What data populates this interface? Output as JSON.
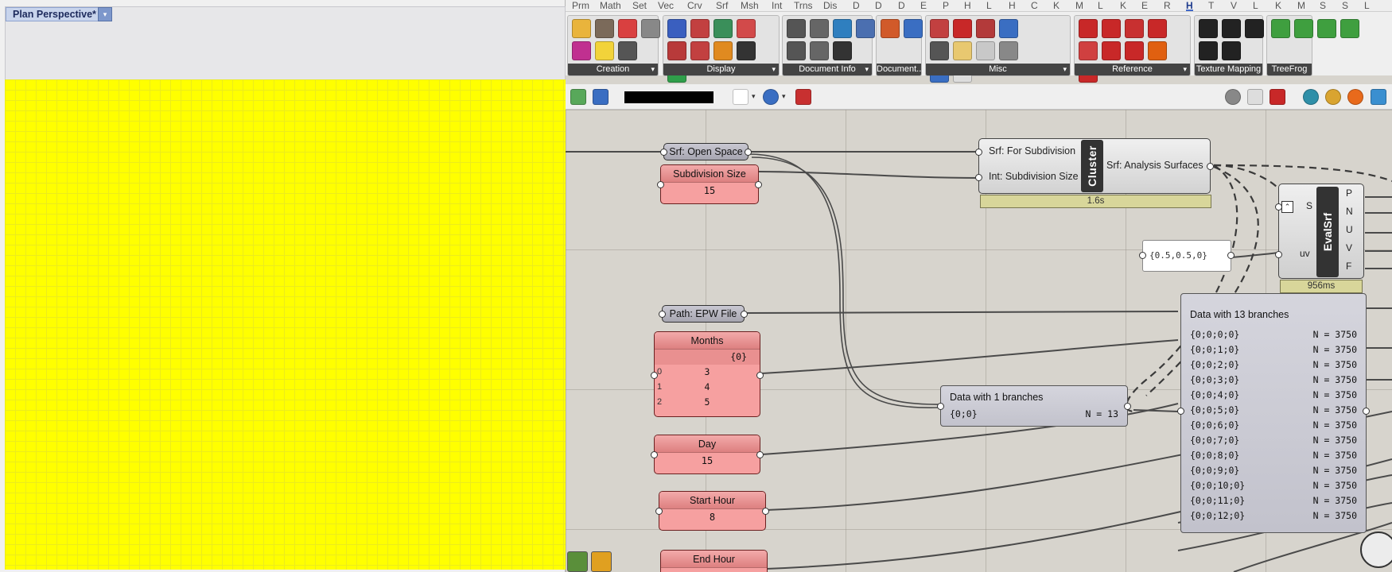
{
  "rhino": {
    "viewport_tab": "Plan Perspective*",
    "viewport_menu_glyph": "▾"
  },
  "grasshopper": {
    "tabs": [
      {
        "label": "Prm"
      },
      {
        "label": "Math"
      },
      {
        "label": "Set"
      },
      {
        "label": "Vec"
      },
      {
        "label": "Crv"
      },
      {
        "label": "Srf"
      },
      {
        "label": "Msh"
      },
      {
        "label": "Int"
      },
      {
        "label": "Trns"
      },
      {
        "label": "Dis"
      },
      {
        "label": "D"
      },
      {
        "label": "D"
      },
      {
        "label": "D"
      },
      {
        "label": "E"
      },
      {
        "label": "P"
      },
      {
        "label": "H"
      },
      {
        "label": "L"
      },
      {
        "label": "H"
      },
      {
        "label": "C"
      },
      {
        "label": "K"
      },
      {
        "label": "M"
      },
      {
        "label": "L"
      },
      {
        "label": "K"
      },
      {
        "label": "E"
      },
      {
        "label": "R"
      },
      {
        "label": "H",
        "active": true
      },
      {
        "label": "T"
      },
      {
        "label": "V"
      },
      {
        "label": "L"
      },
      {
        "label": "K"
      },
      {
        "label": "M"
      },
      {
        "label": "S"
      },
      {
        "label": "S"
      },
      {
        "label": "L"
      }
    ],
    "ribbon_panels": [
      {
        "label": "Creation",
        "icons": [
          "clay-icon",
          "brick-icon",
          "heart-icon",
          "cube-icon",
          "rainbow-icon",
          "bulb-icon",
          "gear-icon"
        ],
        "colors": [
          "#e9b43c",
          "#7b6a5a",
          "#d94040",
          "#888888",
          "#c03090",
          "#f2d33a",
          "#555555"
        ]
      },
      {
        "label": "Display",
        "icons": [
          "bar-chart-icon",
          "curve-chart-icon",
          "scatter-icon",
          "points-icon",
          "arrow-chart-icon",
          "grid-icon",
          "globe-icon",
          "text-tag-icon",
          "gradient-icon"
        ],
        "colors": [
          "#3a5fbf",
          "#c24040",
          "#3a8f5a",
          "#d24a4a",
          "#b83a3a",
          "#c24040",
          "#e08a20",
          "#333333",
          "#2f9e4a"
        ]
      },
      {
        "label": "Document Info",
        "icons": [
          "table-icon",
          "list-icon",
          "palette-icon",
          "grid-icon",
          "doc-icon",
          "layout-icon",
          "camera-icon"
        ],
        "colors": [
          "#555555",
          "#666666",
          "#2f7fbf",
          "#4b6fb0",
          "#555555",
          "#666666",
          "#333333"
        ]
      },
      {
        "label": "Document...",
        "icons": [
          "pen-icon",
          "rings-icon",
          "pencil-icon",
          "frame-icon"
        ],
        "colors": [
          "#d15a2a",
          "#3a6ec2",
          "#c24040",
          "#3f8a4f"
        ]
      },
      {
        "label": "Misc",
        "icons": [
          "marker-icon",
          "cancel-icon",
          "tree-icon",
          "note-icon",
          "printer-icon",
          "fork-icon",
          "cancel-icon",
          "plug-icon",
          "tree-icon",
          "ghost-icon"
        ],
        "colors": [
          "#c24040",
          "#c82828",
          "#b33a3a",
          "#3a6ec2",
          "#555555",
          "#e8c870",
          "#c8c8c8",
          "#888888",
          "#3a6ec2",
          "#dddddd"
        ]
      },
      {
        "label": "Reference",
        "icons": [
          "curve-icon",
          "arrow-icon",
          "lamp-icon",
          "arrow-icon",
          "lamp-icon",
          "pattern-icon",
          "target-icon",
          "cross-icon",
          "cross-icon"
        ],
        "colors": [
          "#c82828",
          "#c82828",
          "#c83030",
          "#c82828",
          "#d04040",
          "#c82828",
          "#c82828",
          "#e06010",
          "#c82828"
        ]
      },
      {
        "label": "Texture Mapping",
        "icons": [
          "checker-icon",
          "checker-icon",
          "checker-icon",
          "duck-icon",
          "checker-icon",
          "checker-icon"
        ],
        "colors": [
          "#222222",
          "#222222",
          "#222222",
          "#e8c020",
          "#222222",
          "#222222"
        ]
      },
      {
        "label": "TreeFrog",
        "icons": [
          "tree-icon",
          "tree-icon",
          "tree-icon",
          "tree-icon"
        ],
        "colors": [
          "#3f9f3f",
          "#3f9f3f",
          "#3f9f3f",
          "#3f9f3f"
        ]
      }
    ],
    "toolbar": {
      "icons": [
        "open-file-icon",
        "save-icon",
        "zoom-extents-icon",
        "eye-icon",
        "brush-icon",
        "preview-shaded-icon",
        "preview-wire-icon",
        "preview-selected-icon",
        "material-icon",
        "sphere-icon",
        "color-icon",
        "extra-icon"
      ]
    },
    "components": {
      "open_space": "Srf: Open Space",
      "subdivision_size": {
        "name": "Subdivision Size",
        "value": "15"
      },
      "path_epw": "Path: EPW File",
      "months": {
        "name": "Months",
        "path": "{0}",
        "rows": [
          {
            "idx": "0",
            "val": "3"
          },
          {
            "idx": "1",
            "val": "4"
          },
          {
            "idx": "2",
            "val": "5"
          }
        ]
      },
      "day": {
        "name": "Day",
        "value": "15"
      },
      "start_hour": {
        "name": "Start Hour",
        "value": "8"
      },
      "end_hour": {
        "name": "End Hour"
      },
      "cluster": {
        "name": "Cluster",
        "input1": "Srf: For Subdivision",
        "input2": "Int: Subdivision Size",
        "output": "Srf: Analysis Surfaces",
        "time": "1.6s"
      },
      "evalsrf": {
        "name": "EvalSrf",
        "in_s": "S",
        "in_uv": "uv",
        "outs": [
          "P",
          "N",
          "U",
          "V",
          "F"
        ],
        "time": "956ms",
        "toggle_glyph": "⌃"
      },
      "uv_panel": "{0.5,0.5,0}",
      "data_1": {
        "title": "Data with 1 branches",
        "path": "{0;0}",
        "count": "N = 13"
      },
      "data_13": {
        "title": "Data with 13 branches",
        "rows": [
          {
            "path": "{0;0;0;0}",
            "count": "N = 3750"
          },
          {
            "path": "{0;0;1;0}",
            "count": "N = 3750"
          },
          {
            "path": "{0;0;2;0}",
            "count": "N = 3750"
          },
          {
            "path": "{0;0;3;0}",
            "count": "N = 3750"
          },
          {
            "path": "{0;0;4;0}",
            "count": "N = 3750"
          },
          {
            "path": "{0;0;5;0}",
            "count": "N = 3750"
          },
          {
            "path": "{0;0;6;0}",
            "count": "N = 3750"
          },
          {
            "path": "{0;0;7;0}",
            "count": "N = 3750"
          },
          {
            "path": "{0;0;8;0}",
            "count": "N = 3750"
          },
          {
            "path": "{0;0;9;0}",
            "count": "N = 3750"
          },
          {
            "path": "{0;0;10;0}",
            "count": "N = 3750"
          },
          {
            "path": "{0;0;11;0}",
            "count": "N = 3750"
          },
          {
            "path": "{0;0;12;0}",
            "count": "N = 3750"
          }
        ]
      }
    }
  }
}
